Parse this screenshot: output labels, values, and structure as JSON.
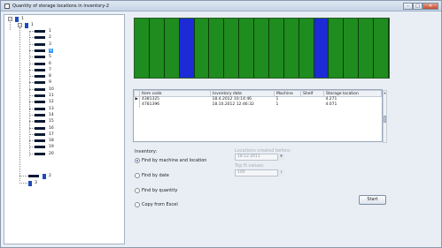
{
  "window": {
    "title": "Quantity of storage locations in inventory-2",
    "buttons": [
      "–",
      "□",
      "✕"
    ]
  },
  "tree": {
    "root_label": "1",
    "child_label": "1",
    "leaves": [
      "1",
      "2",
      "3",
      "4",
      "5",
      "6",
      "7",
      "8",
      "9",
      "10",
      "11",
      "12",
      "13",
      "14",
      "15",
      "16",
      "17",
      "18",
      "19",
      "20"
    ],
    "selected_leaf": "4",
    "siblings": [
      "2",
      "3"
    ]
  },
  "shelf": {
    "stripe_colors": [
      "green",
      "green",
      "green",
      "blue",
      "green",
      "green",
      "green",
      "green",
      "green",
      "green",
      "green",
      "green",
      "blue",
      "green",
      "green",
      "green",
      "green"
    ],
    "colors": {
      "green": "#1e8c1e",
      "blue": "#1d2bd6"
    }
  },
  "grid": {
    "columns": [
      "Item code",
      "Inventory date",
      "Machine",
      "Shelf",
      "Storage location"
    ],
    "rows": [
      {
        "marker": "▶",
        "item_code": "4381325",
        "date": "18.4.2012 10:14:46",
        "machine": "1",
        "shelf": "",
        "location": "4.271"
      },
      {
        "marker": "",
        "item_code": "4781396",
        "date": "18.10.2012 12:46:32",
        "machine": "1",
        "shelf": "",
        "location": "4.071"
      }
    ]
  },
  "inventory": {
    "label": "Inventory:",
    "options": [
      {
        "label": "Find by machine and location",
        "selected": true
      },
      {
        "label": "Find by date",
        "selected": false
      },
      {
        "label": "Find by quantity",
        "selected": false
      },
      {
        "label": "Copy from Excel",
        "selected": false
      }
    ]
  },
  "filters": {
    "locations_label": "Locations created before:",
    "locations_value": "18.12.2011",
    "top_label": "Top N values:",
    "top_value": "100"
  },
  "start_label": "Start"
}
